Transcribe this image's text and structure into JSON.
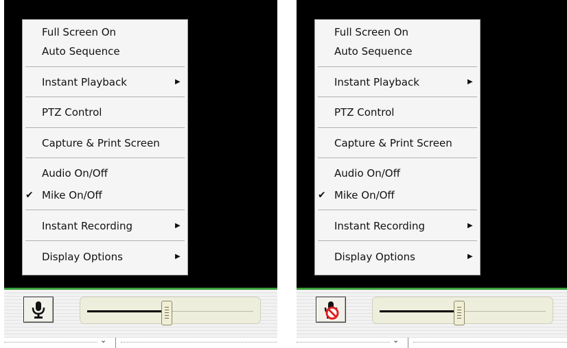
{
  "panels": [
    {
      "id": "left",
      "menu": {
        "items": [
          {
            "label": "Full Screen On",
            "checked": false,
            "submenu": false
          },
          {
            "label": "Auto Sequence",
            "checked": false,
            "submenu": false
          },
          {
            "label": "Instant Playback",
            "checked": false,
            "submenu": true
          },
          {
            "label": "PTZ Control",
            "checked": false,
            "submenu": false
          },
          {
            "label": "Capture & Print Screen",
            "checked": false,
            "submenu": false
          },
          {
            "label": "Audio On/Off",
            "checked": false,
            "submenu": false
          },
          {
            "label": "Mike On/Off",
            "checked": true,
            "submenu": false
          },
          {
            "label": "Instant Recording",
            "checked": false,
            "submenu": true
          },
          {
            "label": "Display Options",
            "checked": false,
            "submenu": true
          }
        ]
      },
      "mic_button": {
        "icon": "microphone-icon",
        "muted": false
      },
      "volume_slider": {
        "value": 0.48
      }
    },
    {
      "id": "right",
      "menu": {
        "items": [
          {
            "label": "Full Screen On",
            "checked": false,
            "submenu": false
          },
          {
            "label": "Auto Sequence",
            "checked": false,
            "submenu": false
          },
          {
            "label": "Instant Playback",
            "checked": false,
            "submenu": true
          },
          {
            "label": "PTZ Control",
            "checked": false,
            "submenu": false
          },
          {
            "label": "Capture & Print Screen",
            "checked": false,
            "submenu": false
          },
          {
            "label": "Audio On/Off",
            "checked": false,
            "submenu": false
          },
          {
            "label": "Mike On/Off",
            "checked": true,
            "submenu": false
          },
          {
            "label": "Instant Recording",
            "checked": false,
            "submenu": true
          },
          {
            "label": "Display Options",
            "checked": false,
            "submenu": true
          }
        ]
      },
      "mic_button": {
        "icon": "microphone-muted-icon",
        "muted": true
      },
      "volume_slider": {
        "value": 0.48
      }
    }
  ],
  "glyphs": {
    "check": "✔",
    "submenu_arrow": "▶",
    "chevron": "⌄"
  },
  "colors": {
    "video_bg": "#000000",
    "accent_line": "#3aa03e",
    "menu_bg": "#f5f5f5",
    "mute_badge": "#e02020"
  }
}
